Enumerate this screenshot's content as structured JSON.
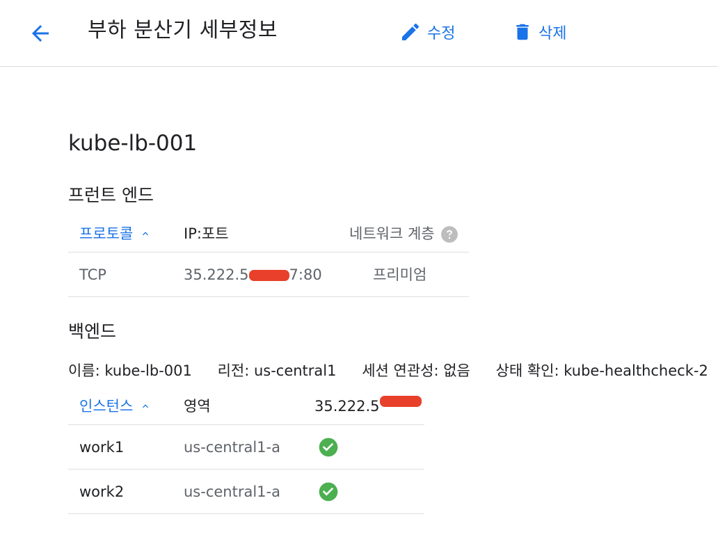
{
  "header": {
    "title": "부하 분산기 세부정보",
    "edit_label": "수정",
    "delete_label": "삭제",
    "icons": {
      "back": "arrow-back-icon",
      "edit": "pencil-icon",
      "delete": "trash-icon"
    },
    "accent_color": "#1a73e8"
  },
  "load_balancer": {
    "name": "kube-lb-001"
  },
  "frontend": {
    "title": "프런트 엔드",
    "columns": {
      "protocol": "프로토콜",
      "ip_port": "IP:포트",
      "network_tier": "네트워크 계층"
    },
    "rows": [
      {
        "protocol": "TCP",
        "ip_prefix": "35.222.5",
        "ip_suffix": "7:80",
        "network_tier": "프리미엄"
      }
    ]
  },
  "backend": {
    "title": "백엔드",
    "info": {
      "name": "이름: kube-lb-001",
      "region": "리전: us-central1",
      "session_affinity": "세션 연관성: 없음",
      "health_check": "상태 확인: kube-healthcheck-2"
    },
    "columns": {
      "instance": "인스턴스",
      "zone": "영역",
      "ip": "35.222.5"
    },
    "instances": [
      {
        "name": "work1",
        "zone": "us-central1-a",
        "status": "healthy",
        "status_icon": "check-circle-icon"
      },
      {
        "name": "work2",
        "zone": "us-central1-a",
        "status": "healthy",
        "status_icon": "check-circle-icon"
      }
    ],
    "healthy_color": "#4caf50"
  }
}
